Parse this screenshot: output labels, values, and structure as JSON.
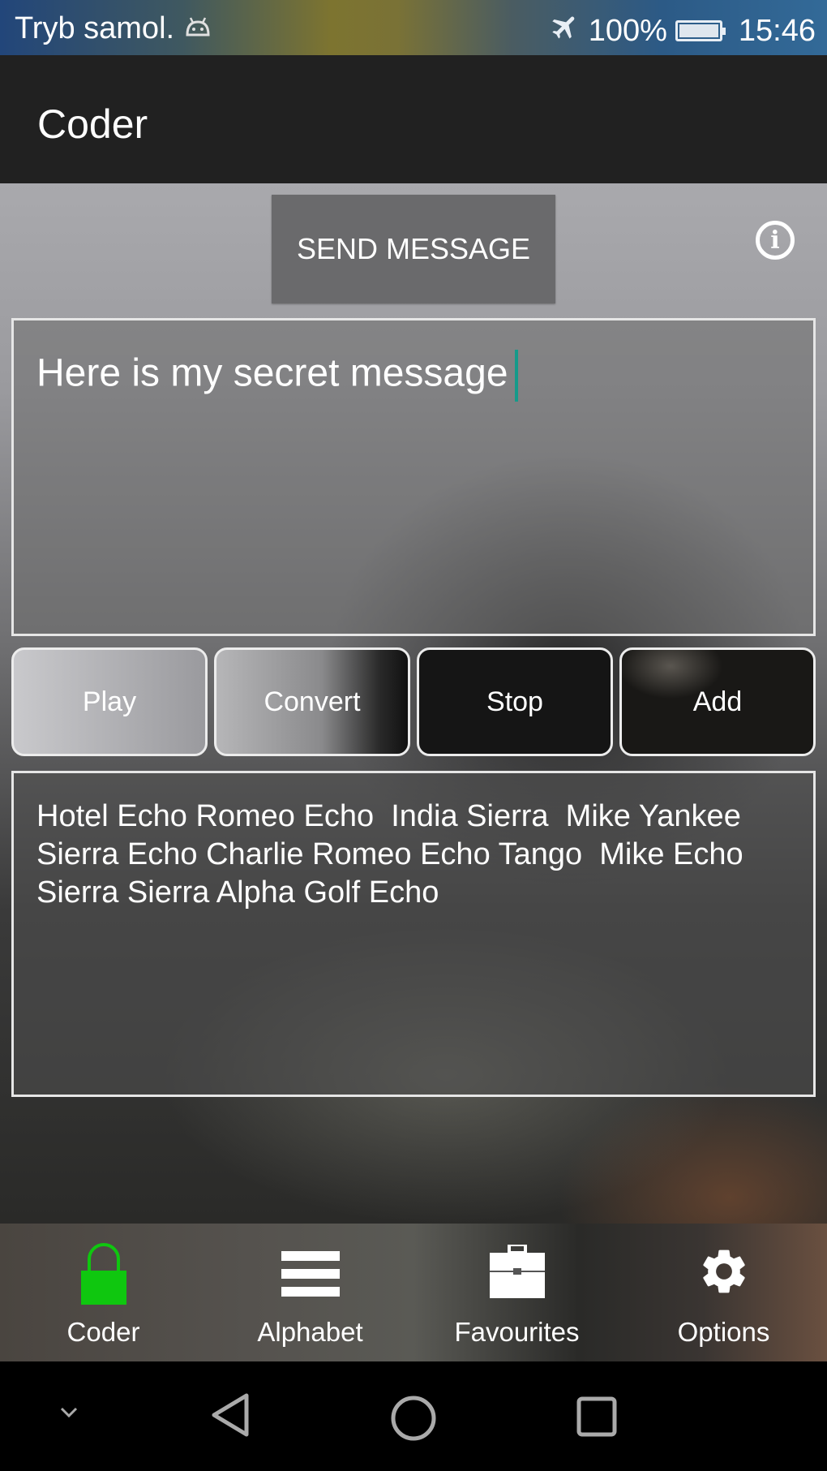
{
  "status_bar": {
    "mode_text": "Tryb samol.",
    "battery_percent": "100%",
    "time": "15:46",
    "icons": [
      "android-icon",
      "airplane-icon",
      "battery-icon"
    ]
  },
  "app_bar": {
    "title": "Coder"
  },
  "main": {
    "send_button_label": "SEND MESSAGE",
    "info_icon": "info-icon",
    "input_text": "Here is my secret message",
    "buttons": [
      {
        "label": "Play"
      },
      {
        "label": "Convert"
      },
      {
        "label": "Stop"
      },
      {
        "label": "Add"
      }
    ],
    "output_text": "Hotel Echo Romeo Echo  India Sierra  Mike Yankee\nSierra Echo Charlie Romeo Echo Tango  Mike Echo\nSierra Sierra Alpha Golf Echo"
  },
  "bottom_nav": {
    "active_color": "#0fc70f",
    "items": [
      {
        "label": "Coder",
        "icon": "lock-icon",
        "active": true
      },
      {
        "label": "Alphabet",
        "icon": "menu-icon",
        "active": false
      },
      {
        "label": "Favourites",
        "icon": "briefcase-icon",
        "active": false
      },
      {
        "label": "Options",
        "icon": "gear-icon",
        "active": false
      }
    ]
  },
  "system_nav": {
    "icons": [
      "chevron-down-icon",
      "back-icon",
      "home-icon",
      "recents-icon"
    ]
  }
}
